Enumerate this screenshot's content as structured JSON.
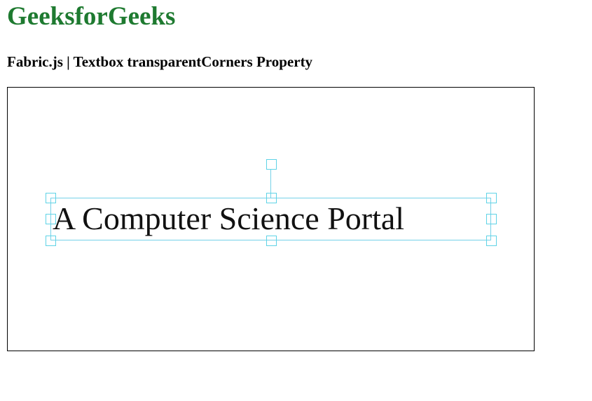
{
  "header": {
    "brand": "GeeksforGeeks",
    "subtitle": "Fabric.js | Textbox transparentCorners Property"
  },
  "canvas": {
    "textbox_text": "A Computer Science Portal",
    "selected": true,
    "transparent_corners": true
  },
  "colors": {
    "brand": "#1e7a30",
    "handle": "#5fd3e6",
    "text": "#111111"
  }
}
